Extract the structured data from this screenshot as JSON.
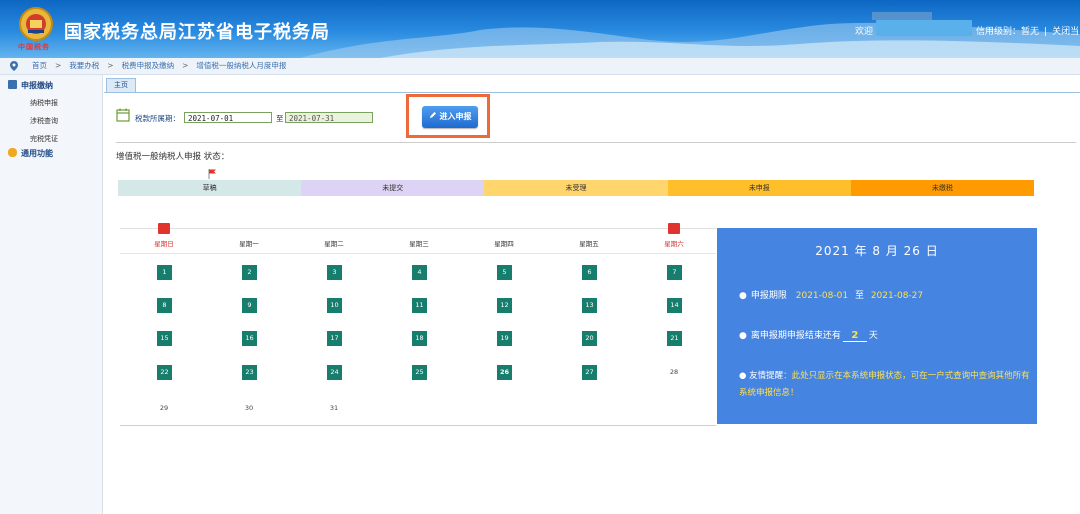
{
  "header": {
    "site_title": "国家税务总局江苏省电子税务局",
    "logo_subtitle": "中国税务",
    "welcome": "欢迎",
    "credit_label": "信用级别：暂无",
    "close_label": "关闭当"
  },
  "breadcrumb": [
    "首页",
    "我要办税",
    "税费申报及缴纳",
    "增值税一般纳税人月度申报"
  ],
  "sidebar": {
    "groups": [
      {
        "label": "申报缴纳",
        "icon": "grid-icon",
        "items": [
          "纳税申报",
          "涉税查询",
          "完税凭证"
        ]
      },
      {
        "label": "通用功能",
        "icon": "chat-icon",
        "items": []
      }
    ]
  },
  "tab": {
    "label": "主页"
  },
  "period": {
    "label": "税款所属期：",
    "from": "2021-07-01",
    "to_label": "至",
    "to": "2021-07-31"
  },
  "enter_button": {
    "label": "进入申报"
  },
  "status_heading": "增值税一般纳税人申报 状态：",
  "legend": [
    {
      "label": "草稿",
      "color": "#d4e8e8"
    },
    {
      "label": "未提交",
      "color": "#ddd3f4"
    },
    {
      "label": "未受理",
      "color": "#ffd56e"
    },
    {
      "label": "未申报",
      "color": "#ffbf2a"
    },
    {
      "label": "未缴税",
      "color": "#ff9a00"
    }
  ],
  "calendar": {
    "weekdays": [
      "星期日",
      "星期一",
      "星期二",
      "星期三",
      "星期四",
      "星期五",
      "星期六"
    ],
    "weeks": [
      [
        "1",
        "2",
        "3",
        "4",
        "5",
        "6",
        "7"
      ],
      [
        "8",
        "9",
        "10",
        "11",
        "12",
        "13",
        "14"
      ],
      [
        "15",
        "16",
        "17",
        "18",
        "19",
        "20",
        "21"
      ],
      [
        "22",
        "23",
        "24",
        "25",
        "26",
        "27",
        "28"
      ],
      [
        "29",
        "30",
        "31",
        "",
        "",
        "",
        ""
      ]
    ],
    "today": "26",
    "plain_days": [
      "28",
      "29",
      "30",
      "31"
    ]
  },
  "info": {
    "date": "2021 年 8 月 26 日",
    "period_label": "申报期限",
    "period_from": "2021-08-01",
    "period_to_label": "至",
    "period_to": "2021-08-27",
    "remaining_prefix": "离申报期申报结束还有",
    "remaining_days": "2",
    "remaining_suffix": "天",
    "notice_lead": "友情提醒",
    "notice_text": "：此处只显示在本系统申报状态，可在一户式查询中查询其他所有系统申报信息！"
  },
  "colors": {
    "accent": "#4684e2",
    "day_cell": "#177e6e",
    "highlight": "#ef6a3a"
  }
}
